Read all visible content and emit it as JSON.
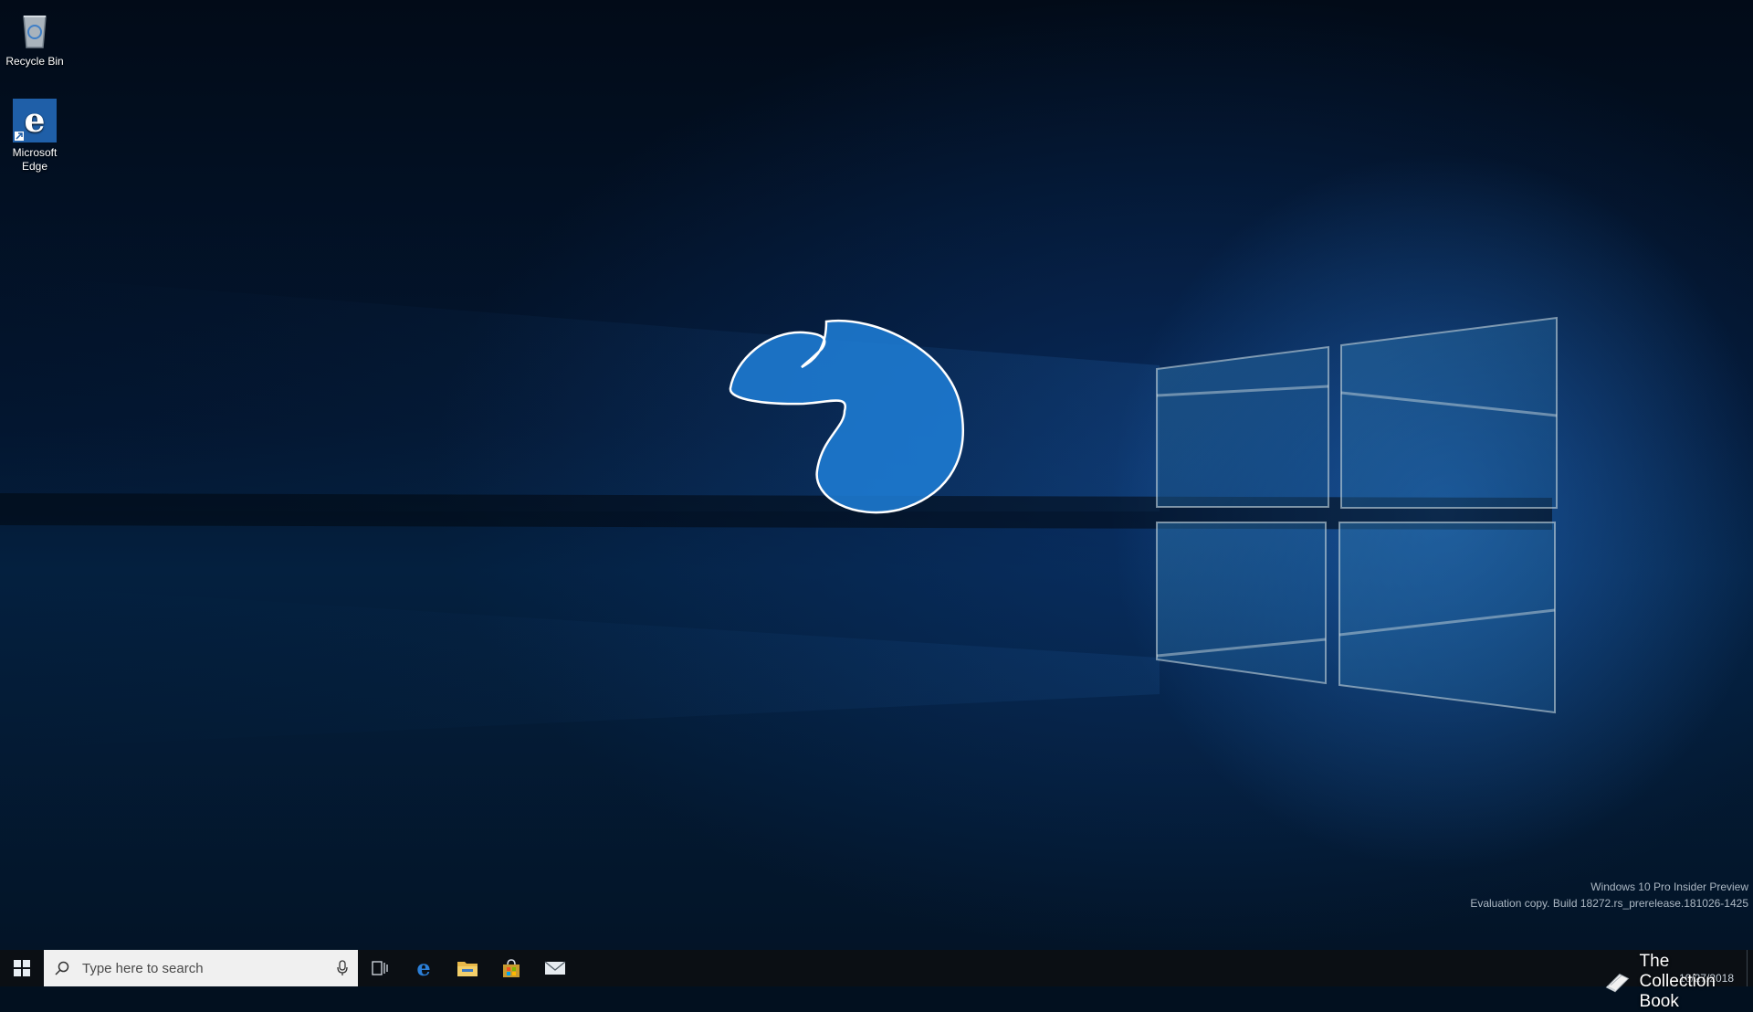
{
  "desktop": {
    "icons": [
      {
        "label": "Recycle Bin",
        "icon": "recycle-bin-icon"
      },
      {
        "label": "Microsoft Edge",
        "icon": "edge-icon"
      }
    ],
    "watermark": {
      "line1": "Windows 10 Pro Insider Preview",
      "line2": "Evaluation copy. Build 18272.rs_prerelease.181026-1425"
    }
  },
  "taskbar": {
    "start_icon": "windows-logo-icon",
    "search": {
      "placeholder": "Type here to search",
      "icon": "search-icon",
      "mic_icon": "microphone-icon"
    },
    "pinned": [
      {
        "name": "task-view",
        "icon": "task-view-icon"
      },
      {
        "name": "edge",
        "icon": "edge-icon"
      },
      {
        "name": "file-explorer",
        "icon": "folder-icon"
      },
      {
        "name": "store",
        "icon": "store-bag-icon"
      },
      {
        "name": "mail",
        "icon": "mail-icon"
      }
    ],
    "tray": {
      "date": "10/27/2018",
      "brand_text": "The Collection Book",
      "brand_icon": "book-icon"
    }
  },
  "colors": {
    "accent": "#1a7fd8",
    "taskbar": "#0b0f14",
    "search_bg": "#f0f0f0"
  }
}
